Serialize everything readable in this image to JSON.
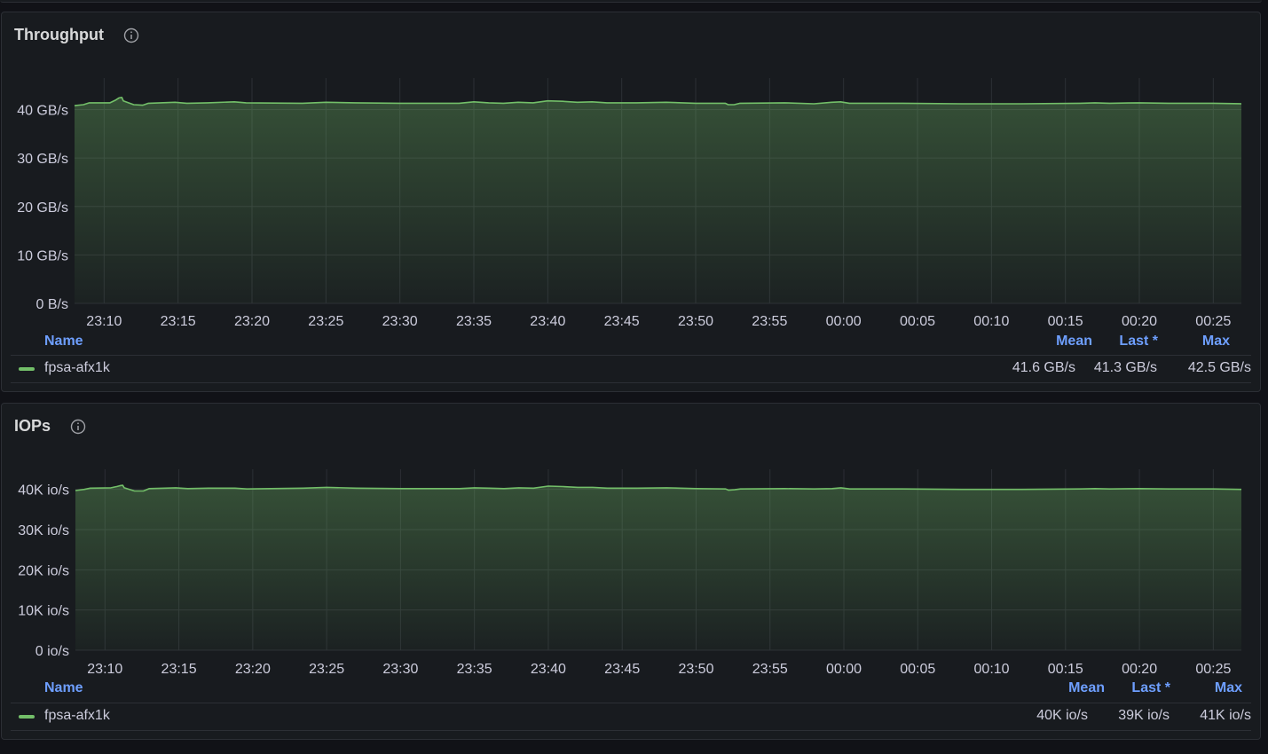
{
  "panels": [
    {
      "title": "Throughput",
      "legend": {
        "headers": {
          "name": "Name",
          "mean": "Mean",
          "last": "Last *",
          "max": "Max"
        },
        "series_name": "fpsa-afx1k",
        "mean": "41.6 GB/s",
        "last": "41.3 GB/s",
        "max": "42.5 GB/s"
      }
    },
    {
      "title": "IOPs",
      "legend": {
        "headers": {
          "name": "Name",
          "mean": "Mean",
          "last": "Last *",
          "max": "Max"
        },
        "series_name": "fpsa-afx1k",
        "mean": "40K io/s",
        "last": "39K io/s",
        "max": "41K io/s"
      }
    }
  ],
  "colors": {
    "series": "#73bf69",
    "panel_bg": "#181b1f",
    "page_bg": "#111217",
    "legend_header": "#6e9fff",
    "grid": "#2c2f35"
  },
  "chart_data": [
    {
      "type": "area",
      "title": "Throughput",
      "ylabel": "",
      "ylim": [
        0,
        46.5
      ],
      "y_ticks": [
        0,
        10,
        20,
        30,
        40
      ],
      "y_tick_labels": [
        "0 B/s",
        "10 GB/s",
        "20 GB/s",
        "30 GB/s",
        "40 GB/s"
      ],
      "x_tick_labels": [
        "23:10",
        "23:15",
        "23:20",
        "23:25",
        "23:30",
        "23:35",
        "23:40",
        "23:45",
        "23:50",
        "23:55",
        "00:00",
        "00:05",
        "00:10",
        "00:15",
        "00:20",
        "00:25"
      ],
      "x_tick_minutes": [
        2,
        7,
        12,
        17,
        22,
        27,
        32,
        37,
        42,
        47,
        52,
        57,
        62,
        67,
        72,
        77
      ],
      "xlim_minutes": [
        0,
        78.9
      ],
      "grid": true,
      "legend": "bottom",
      "series": [
        {
          "name": "fpsa-afx1k",
          "x_minutes": [
            0,
            0.6,
            1.0,
            2.4,
            2.8,
            3.0,
            3.2,
            3.3,
            4.0,
            4.6,
            5.0,
            6.8,
            7.6,
            9.0,
            10.8,
            11.6,
            15.4,
            17.0,
            19.0,
            22.0,
            26.0,
            27.0,
            28.0,
            29.0,
            30.0,
            31.0,
            32.0,
            33.0,
            34.0,
            35.0,
            36.0,
            38.0,
            40.0,
            42.0,
            44.0,
            44.2,
            44.6,
            45.0,
            48.0,
            50.0,
            51.2,
            51.8,
            52.4,
            56.0,
            60.0,
            64.0,
            68.0,
            69.0,
            70.0,
            72.0,
            74.0,
            77.0,
            78.9
          ],
          "values": [
            40.8,
            41.0,
            41.4,
            41.4,
            42.0,
            42.4,
            42.5,
            41.8,
            41.0,
            40.9,
            41.3,
            41.5,
            41.3,
            41.4,
            41.6,
            41.4,
            41.3,
            41.5,
            41.4,
            41.3,
            41.3,
            41.6,
            41.4,
            41.3,
            41.5,
            41.4,
            41.8,
            41.7,
            41.5,
            41.6,
            41.4,
            41.4,
            41.5,
            41.3,
            41.3,
            41.0,
            41.0,
            41.3,
            41.4,
            41.2,
            41.5,
            41.6,
            41.3,
            41.3,
            41.2,
            41.2,
            41.3,
            41.4,
            41.3,
            41.4,
            41.3,
            41.3,
            41.2
          ]
        }
      ]
    },
    {
      "type": "area",
      "title": "IOPs",
      "ylabel": "",
      "ylim": [
        0,
        45
      ],
      "y_ticks": [
        0,
        10,
        20,
        30,
        40
      ],
      "y_tick_labels": [
        "0 io/s",
        "10K io/s",
        "20K io/s",
        "30K io/s",
        "40K io/s"
      ],
      "x_tick_labels": [
        "23:10",
        "23:15",
        "23:20",
        "23:25",
        "23:30",
        "23:35",
        "23:40",
        "23:45",
        "23:50",
        "23:55",
        "00:00",
        "00:05",
        "00:10",
        "00:15",
        "00:20",
        "00:25"
      ],
      "x_tick_minutes": [
        2,
        7,
        12,
        17,
        22,
        27,
        32,
        37,
        42,
        47,
        52,
        57,
        62,
        67,
        72,
        77
      ],
      "xlim_minutes": [
        0,
        78.9
      ],
      "grid": true,
      "legend": "bottom",
      "series": [
        {
          "name": "fpsa-afx1k",
          "x_minutes": [
            0,
            0.6,
            1.0,
            2.4,
            2.8,
            3.0,
            3.2,
            3.3,
            4.0,
            4.6,
            5.0,
            6.8,
            7.6,
            9.0,
            10.8,
            11.6,
            15.4,
            17.0,
            19.0,
            22.0,
            26.0,
            27.0,
            28.0,
            29.0,
            30.0,
            31.0,
            32.0,
            33.0,
            34.0,
            35.0,
            36.0,
            38.0,
            40.0,
            42.0,
            44.0,
            44.2,
            44.6,
            45.0,
            48.0,
            50.0,
            51.2,
            51.8,
            52.4,
            56.0,
            60.0,
            64.0,
            68.0,
            69.0,
            70.0,
            72.0,
            74.0,
            77.0,
            78.9
          ],
          "values": [
            39.7,
            40.0,
            40.3,
            40.4,
            40.7,
            40.9,
            41.0,
            40.4,
            39.6,
            39.6,
            40.2,
            40.4,
            40.2,
            40.3,
            40.3,
            40.1,
            40.3,
            40.5,
            40.3,
            40.2,
            40.2,
            40.4,
            40.3,
            40.2,
            40.4,
            40.3,
            40.8,
            40.7,
            40.5,
            40.5,
            40.3,
            40.3,
            40.4,
            40.2,
            40.1,
            39.8,
            39.9,
            40.1,
            40.2,
            40.1,
            40.2,
            40.4,
            40.1,
            40.1,
            40.0,
            40.0,
            40.1,
            40.2,
            40.1,
            40.2,
            40.1,
            40.1,
            40.0
          ]
        }
      ]
    }
  ]
}
